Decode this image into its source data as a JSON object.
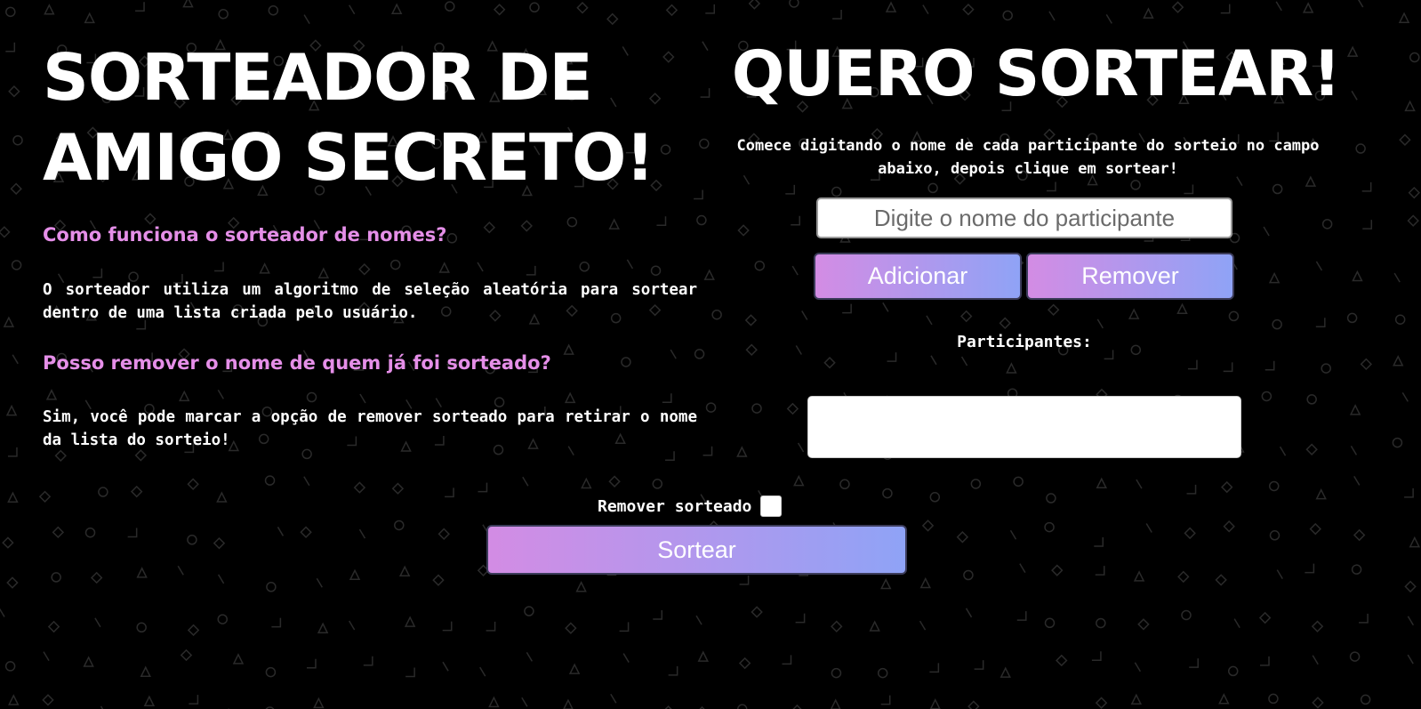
{
  "left": {
    "title": "SORTEADOR DE AMIGO SECRETO!",
    "faq": [
      {
        "question": "Como funciona o sorteador de nomes?",
        "answer": "O sorteador utiliza um algoritmo de seleção aleatória para sortear dentro de uma lista criada pelo usuário."
      },
      {
        "question": "Posso remover o nome de quem já foi sorteado?",
        "answer": "Sim, você pode marcar a opção de remover sorteado para retirar o nome da lista do sorteio!"
      }
    ]
  },
  "right": {
    "title": "QUERO SORTEAR!",
    "instructions": "Comece digitando o nome de cada participante do sorteio no campo abaixo, depois clique em sortear!",
    "input_placeholder": "Digite o nome do participante",
    "add_label": "Adicionar",
    "remove_label": "Remover",
    "participants_label": "Participantes:",
    "participants": []
  },
  "footer": {
    "remove_drawn_label": "Remover sorteado",
    "remove_drawn_checked": false,
    "draw_label": "Sortear"
  },
  "colors": {
    "background": "#000000",
    "accent_text": "#e58fe8",
    "gradient_start": "#d38ce4",
    "gradient_end": "#8fa3f6"
  }
}
